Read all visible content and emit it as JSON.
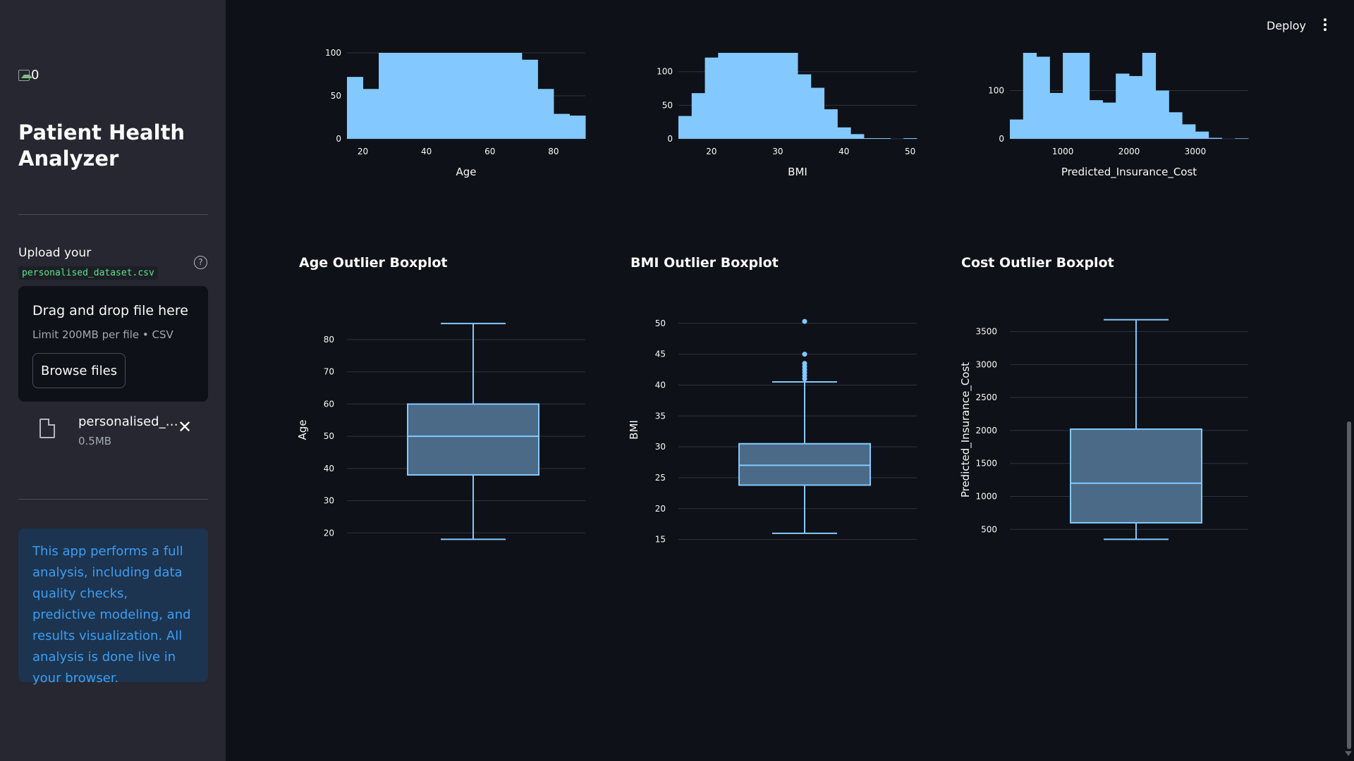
{
  "sidebar": {
    "logo_alt": "0",
    "title": "Patient Health Analyzer",
    "upload_label": "Upload your",
    "upload_filename_code": "personalised_dataset.csv",
    "dropzone_title": "Drag and drop file here",
    "dropzone_limit": "Limit 200MB per file • CSV",
    "browse_label": "Browse files",
    "file_name": "personalised_dataset.csv",
    "file_size": "0.5MB",
    "info_text": "This app performs a full analysis, including data quality checks, predictive modeling, and results visualization. All analysis is done live in your browser."
  },
  "header": {
    "deploy_label": "Deploy"
  },
  "colors": {
    "bar": "#83c9ff",
    "box_fill": "#4a6a88",
    "box_stroke": "#83c9ff",
    "grid": "#31333f"
  },
  "chart_data": [
    {
      "type": "bar",
      "chart": "histogram",
      "xlabel": "Age",
      "xticks": [
        20,
        40,
        60,
        80
      ],
      "yticks": [
        0,
        50,
        100
      ],
      "xlim": [
        15,
        90
      ],
      "ylim": [
        0,
        100
      ],
      "bins": [
        {
          "x0": 15,
          "x1": 20,
          "count": 72
        },
        {
          "x0": 20,
          "x1": 25,
          "count": 58
        },
        {
          "x0": 25,
          "x1": 30,
          "count": 100
        },
        {
          "x0": 30,
          "x1": 35,
          "count": 100
        },
        {
          "x0": 35,
          "x1": 40,
          "count": 100
        },
        {
          "x0": 40,
          "x1": 45,
          "count": 100
        },
        {
          "x0": 45,
          "x1": 50,
          "count": 100
        },
        {
          "x0": 50,
          "x1": 55,
          "count": 100
        },
        {
          "x0": 55,
          "x1": 60,
          "count": 100
        },
        {
          "x0": 60,
          "x1": 65,
          "count": 100
        },
        {
          "x0": 65,
          "x1": 70,
          "count": 100
        },
        {
          "x0": 70,
          "x1": 75,
          "count": 92
        },
        {
          "x0": 75,
          "x1": 80,
          "count": 58
        },
        {
          "x0": 80,
          "x1": 85,
          "count": 29
        },
        {
          "x0": 85,
          "x1": 90,
          "count": 27
        }
      ]
    },
    {
      "type": "bar",
      "chart": "histogram",
      "xlabel": "BMI",
      "xticks": [
        20,
        30,
        40,
        50
      ],
      "yticks": [
        0,
        50,
        100
      ],
      "xlim": [
        15,
        51
      ],
      "ylim": [
        0,
        128
      ],
      "bins": [
        {
          "x0": 15,
          "x1": 17,
          "count": 34
        },
        {
          "x0": 17,
          "x1": 19,
          "count": 68
        },
        {
          "x0": 19,
          "x1": 21,
          "count": 121
        },
        {
          "x0": 21,
          "x1": 23,
          "count": 128
        },
        {
          "x0": 23,
          "x1": 25,
          "count": 128
        },
        {
          "x0": 25,
          "x1": 27,
          "count": 128
        },
        {
          "x0": 27,
          "x1": 29,
          "count": 128
        },
        {
          "x0": 29,
          "x1": 31,
          "count": 128
        },
        {
          "x0": 31,
          "x1": 33,
          "count": 128
        },
        {
          "x0": 33,
          "x1": 35,
          "count": 96
        },
        {
          "x0": 35,
          "x1": 37,
          "count": 76
        },
        {
          "x0": 37,
          "x1": 39,
          "count": 44
        },
        {
          "x0": 39,
          "x1": 41,
          "count": 17
        },
        {
          "x0": 41,
          "x1": 43,
          "count": 7
        },
        {
          "x0": 43,
          "x1": 45,
          "count": 1
        },
        {
          "x0": 45,
          "x1": 47,
          "count": 1
        },
        {
          "x0": 47,
          "x1": 49,
          "count": 0
        },
        {
          "x0": 49,
          "x1": 51,
          "count": 1
        }
      ]
    },
    {
      "type": "bar",
      "chart": "histogram",
      "xlabel": "Predicted_Insurance_Cost",
      "xticks": [
        1000,
        2000,
        3000
      ],
      "yticks": [
        0,
        100
      ],
      "xlim": [
        200,
        3800
      ],
      "ylim": [
        0,
        178
      ],
      "bins": [
        {
          "x0": 200,
          "x1": 400,
          "count": 40
        },
        {
          "x0": 400,
          "x1": 600,
          "count": 178
        },
        {
          "x0": 600,
          "x1": 800,
          "count": 170
        },
        {
          "x0": 800,
          "x1": 1000,
          "count": 95
        },
        {
          "x0": 1000,
          "x1": 1200,
          "count": 178
        },
        {
          "x0": 1200,
          "x1": 1400,
          "count": 178
        },
        {
          "x0": 1400,
          "x1": 1600,
          "count": 80
        },
        {
          "x0": 1600,
          "x1": 1800,
          "count": 75
        },
        {
          "x0": 1800,
          "x1": 2000,
          "count": 135
        },
        {
          "x0": 2000,
          "x1": 2200,
          "count": 130
        },
        {
          "x0": 2200,
          "x1": 2400,
          "count": 178
        },
        {
          "x0": 2400,
          "x1": 2600,
          "count": 100
        },
        {
          "x0": 2600,
          "x1": 2800,
          "count": 55
        },
        {
          "x0": 2800,
          "x1": 3000,
          "count": 30
        },
        {
          "x0": 3000,
          "x1": 3200,
          "count": 15
        },
        {
          "x0": 3200,
          "x1": 3400,
          "count": 2
        },
        {
          "x0": 3400,
          "x1": 3600,
          "count": 0
        },
        {
          "x0": 3600,
          "x1": 3800,
          "count": 1
        }
      ]
    },
    {
      "type": "box",
      "title": "Age Outlier Boxplot",
      "ylabel": "Age",
      "yticks": [
        20,
        30,
        40,
        50,
        60,
        70,
        80
      ],
      "ylim": [
        17,
        87
      ],
      "min": 18,
      "q1": 38,
      "median": 50,
      "q3": 60,
      "max": 85,
      "outliers": []
    },
    {
      "type": "box",
      "title": "BMI Outlier Boxplot",
      "ylabel": "BMI",
      "yticks": [
        15,
        20,
        25,
        30,
        35,
        40,
        45,
        50
      ],
      "ylim": [
        14.5,
        51
      ],
      "min": 16,
      "q1": 23.8,
      "median": 27,
      "q3": 30.5,
      "max": 40.5,
      "outliers": [
        41,
        41.5,
        42,
        42.5,
        43,
        43.5,
        45,
        50.3
      ]
    },
    {
      "type": "box",
      "title": "Cost Outlier Boxplot",
      "ylabel": "Predicted_Insurance_Cost",
      "yticks": [
        500,
        1000,
        1500,
        2000,
        2500,
        3000,
        3500
      ],
      "ylim": [
        300,
        3720
      ],
      "min": 350,
      "q1": 600,
      "median": 1200,
      "q3": 2020,
      "max": 3680,
      "outliers": []
    }
  ]
}
